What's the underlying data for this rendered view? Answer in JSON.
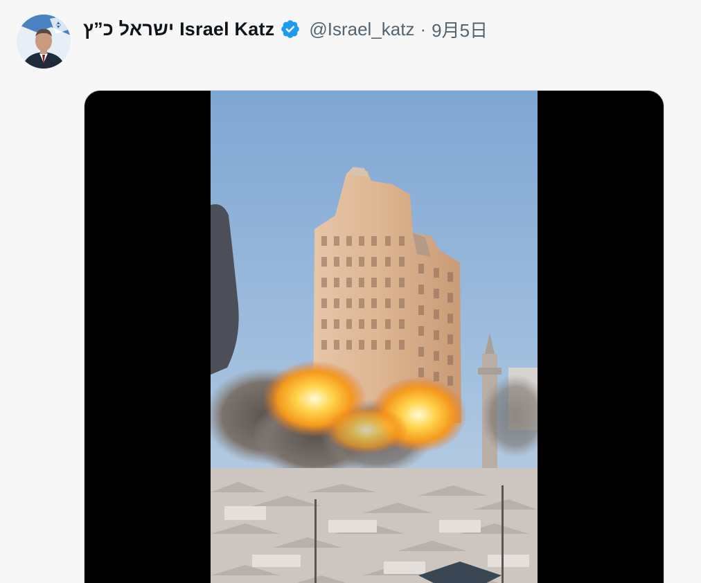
{
  "tweet": {
    "display_name": "ישראל כ”ץ Israel Katz",
    "handle": "@Israel_katz",
    "separator": "·",
    "date": "9月5日"
  },
  "icons": {
    "verified": "verified-badge-icon",
    "avatar": "profile-avatar"
  },
  "media": {
    "type": "video",
    "description_words": "building-explosion"
  },
  "colors": {
    "verified_blue": "#1d9bf0",
    "handle_gray": "#536471",
    "name_black": "#0f1419",
    "background": "#f7f7f7"
  }
}
